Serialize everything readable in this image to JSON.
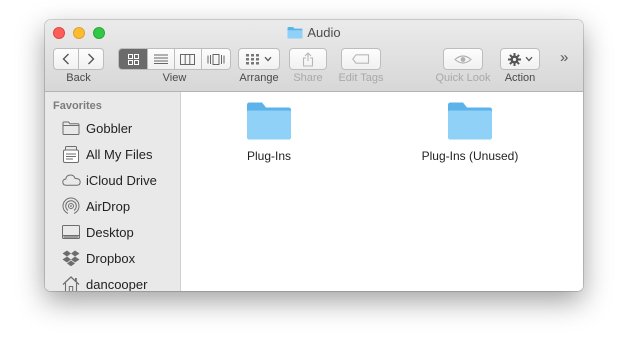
{
  "window": {
    "title": "Audio",
    "title_icon": "folder-icon"
  },
  "toolbar": {
    "back_label": "Back",
    "view_label": "View",
    "arrange_label": "Arrange",
    "share_label": "Share",
    "edit_tags_label": "Edit Tags",
    "quick_look_label": "Quick Look",
    "action_label": "Action",
    "view_modes": [
      "icon-view",
      "list-view",
      "column-view",
      "cover-flow-view"
    ],
    "active_view": "icon-view",
    "overflow_glyph": "»"
  },
  "sidebar": {
    "heading": "Favorites",
    "items": [
      {
        "label": "Gobbler",
        "icon": "folder-icon"
      },
      {
        "label": "All My Files",
        "icon": "all-my-files-icon"
      },
      {
        "label": "iCloud Drive",
        "icon": "cloud-icon"
      },
      {
        "label": "AirDrop",
        "icon": "airdrop-icon"
      },
      {
        "label": "Desktop",
        "icon": "desktop-icon"
      },
      {
        "label": "Dropbox",
        "icon": "dropbox-icon"
      },
      {
        "label": "dancooper",
        "icon": "home-icon"
      }
    ]
  },
  "files": [
    {
      "name": "Plug-Ins",
      "icon": "folder-icon"
    },
    {
      "name": "Plug-Ins (Unused)",
      "icon": "folder-icon"
    }
  ],
  "colors": {
    "folder_light": "#8fd1f7",
    "folder_dark": "#5bb3ea",
    "sidebar_bg": "#e9e9e9",
    "toolbar_top": "#ebebeb",
    "toolbar_bottom": "#d7d7d7"
  }
}
